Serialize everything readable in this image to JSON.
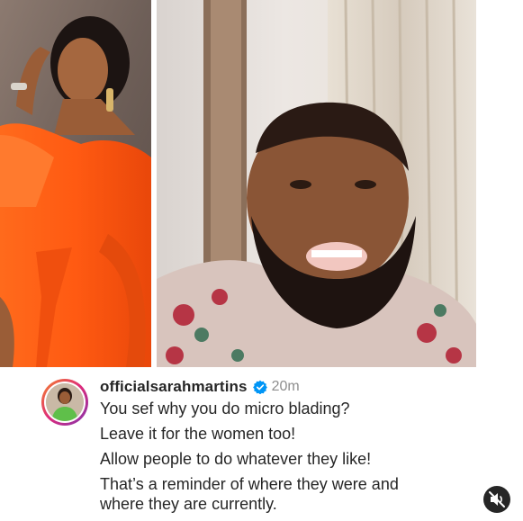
{
  "post": {
    "comment": {
      "username": "officialsarahmartins",
      "timestamp": "20m",
      "lines": [
        "You sef why you do micro blading?",
        "Leave it for the women too!",
        "Allow people to do whatever they like!",
        "That’s a reminder of where they were and where they are currently."
      ]
    },
    "icons": {
      "verified": "verified-badge-icon",
      "mute": "muted-speaker-icon"
    },
    "colors": {
      "verified_blue": "#0095f6",
      "text": "#262626",
      "muted_text": "#8e8e8e",
      "dress_orange": "#ff5a12"
    }
  }
}
